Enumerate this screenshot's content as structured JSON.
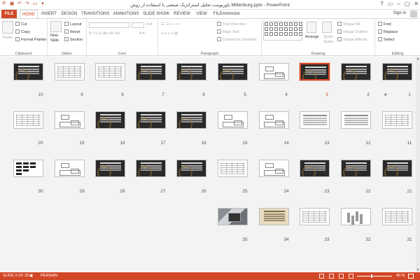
{
  "window": {
    "title": "پاورپوینت تحلیل استراتژیک صنعتی با استفاده از روش Miltenburg.pptx - PowerPoint",
    "sign_in": "Sign in",
    "controls": [
      "?",
      "▭",
      "–",
      "▢",
      "✕"
    ]
  },
  "tabs": [
    {
      "label": "FILE"
    },
    {
      "label": "HOME",
      "active": true
    },
    {
      "label": "INSERT"
    },
    {
      "label": "DESIGN"
    },
    {
      "label": "TRANSITIONS"
    },
    {
      "label": "ANIMATIONS"
    },
    {
      "label": "SLIDE SHOW"
    },
    {
      "label": "REVIEW"
    },
    {
      "label": "VIEW"
    },
    {
      "label": "FILEminimizer"
    }
  ],
  "ribbon": {
    "clipboard": {
      "paste": "Paste",
      "cut": "Cut",
      "copy": "Copy",
      "format_painter": "Format Painter",
      "label": "Clipboard"
    },
    "slides": {
      "new_slide": "New",
      "new_slide2": "Slide",
      "layout": "Layout",
      "reset": "Reset",
      "section": "Section",
      "label": "Slides"
    },
    "font": {
      "label": "Font"
    },
    "paragraph": {
      "text_direction": "Text Direction",
      "align_text": "Align Text",
      "smartart": "Convert to SmartArt",
      "label": "Paragraph"
    },
    "drawing": {
      "arrange": "Arrange",
      "quick_styles": "Quick",
      "quick_styles2": "Styles",
      "shape_fill": "Shape Fill",
      "shape_outline": "Shape Outline",
      "shape_effects": "Shape Effects",
      "label": "Drawing"
    },
    "editing": {
      "find": "Find",
      "replace": "Replace",
      "select": "Select",
      "label": "Editing"
    }
  },
  "slides": [
    {
      "num": "1",
      "style": "dark",
      "star": "★"
    },
    {
      "num": "2",
      "style": "dark"
    },
    {
      "num": "3",
      "style": "dark",
      "selected": true
    },
    {
      "num": "4",
      "style": "diagram"
    },
    {
      "num": "5",
      "style": "dark"
    },
    {
      "num": "6",
      "style": "dark"
    },
    {
      "num": "7",
      "style": "dark"
    },
    {
      "num": "8",
      "style": "table"
    },
    {
      "num": "9",
      "style": "table"
    },
    {
      "num": "10",
      "style": "dark"
    },
    {
      "num": "11",
      "style": "table"
    },
    {
      "num": "12",
      "style": "text"
    },
    {
      "num": "13",
      "style": "text"
    },
    {
      "num": "14",
      "style": "diagram"
    },
    {
      "num": "15",
      "style": "diagram"
    },
    {
      "num": "16",
      "style": "dark"
    },
    {
      "num": "17",
      "style": "dark"
    },
    {
      "num": "18",
      "style": "dark"
    },
    {
      "num": "19",
      "style": "diagram"
    },
    {
      "num": "20",
      "style": "table"
    },
    {
      "num": "21",
      "style": "dark"
    },
    {
      "num": "22",
      "style": "dark"
    },
    {
      "num": "23",
      "style": "dark"
    },
    {
      "num": "24",
      "style": "diagram"
    },
    {
      "num": "25",
      "style": "table"
    },
    {
      "num": "26",
      "style": "dark"
    },
    {
      "num": "27",
      "style": "dark"
    },
    {
      "num": "28",
      "style": "dark"
    },
    {
      "num": "29",
      "style": "diagram"
    },
    {
      "num": "30",
      "style": "blocks"
    },
    {
      "num": "31",
      "style": "table"
    },
    {
      "num": "32",
      "style": "chart"
    },
    {
      "num": "33",
      "style": "table"
    },
    {
      "num": "34",
      "style": "paper"
    },
    {
      "num": "35",
      "style": "photo"
    }
  ],
  "status": {
    "slide_info": "SLIDE 3 OF 35",
    "language": "PERSIAN",
    "zoom": "40 %"
  },
  "colors": {
    "accent": "#d24726",
    "sorter_bg": "#f3f3f3"
  }
}
